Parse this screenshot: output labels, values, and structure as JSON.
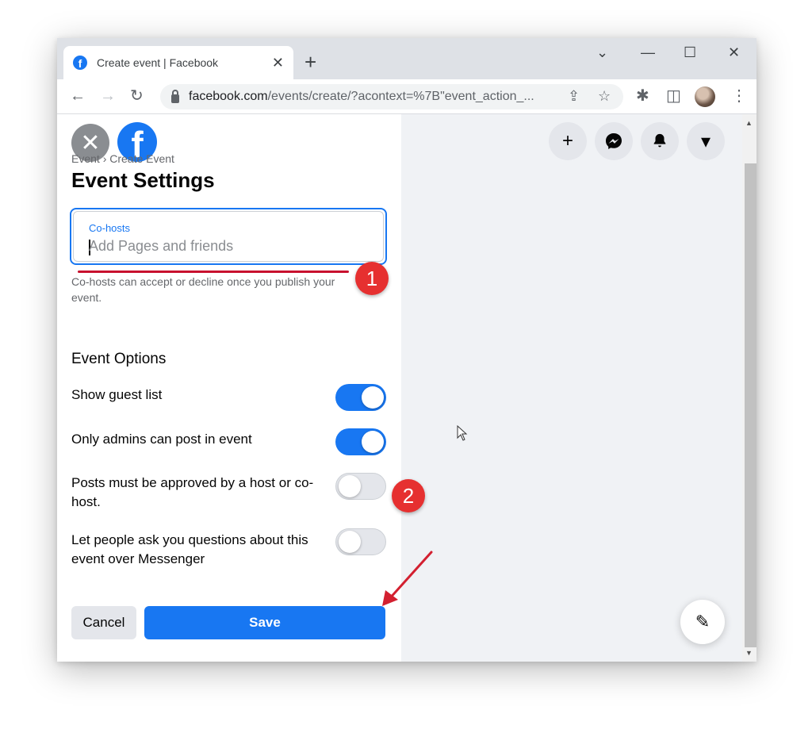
{
  "browser": {
    "tab_title": "Create event | Facebook",
    "tab_close": "✕",
    "new_tab": "+",
    "win_min": "—",
    "win_max": "☐",
    "win_close": "✕",
    "win_chevron": "⌄",
    "url_host": "facebook.com",
    "url_path": "/events/create/?acontext=%7B\"event_action_..."
  },
  "icons": {
    "back": "←",
    "forward": "→",
    "reload": "↻",
    "share": "⇪",
    "star": "☆",
    "extensions": "✱",
    "sidepanel": "◫",
    "menu": "⋮",
    "close_x": "✕",
    "plus": "+",
    "caret": "▾",
    "compose": "✎"
  },
  "panel": {
    "breadcrumb": "Event › Create Event",
    "title": "Event Settings",
    "cohosts_label": "Co-hosts",
    "cohosts_placeholder": "Add Pages and friends",
    "cohosts_value": "",
    "helper": "Co-hosts can accept or decline once you publish your event.",
    "options_title": "Event Options",
    "options": [
      {
        "label": "Show guest list",
        "on": true
      },
      {
        "label": "Only admins can post in event",
        "on": true
      },
      {
        "label": "Posts must be approved by a host or co-host.",
        "on": false
      },
      {
        "label": "Let people ask you questions about this event over Messenger",
        "on": false
      }
    ],
    "cancel": "Cancel",
    "save": "Save"
  },
  "annotations": {
    "badge1": "1",
    "badge2": "2"
  },
  "colors": {
    "facebook_blue": "#1877f2",
    "annotation_red": "#e63030"
  }
}
